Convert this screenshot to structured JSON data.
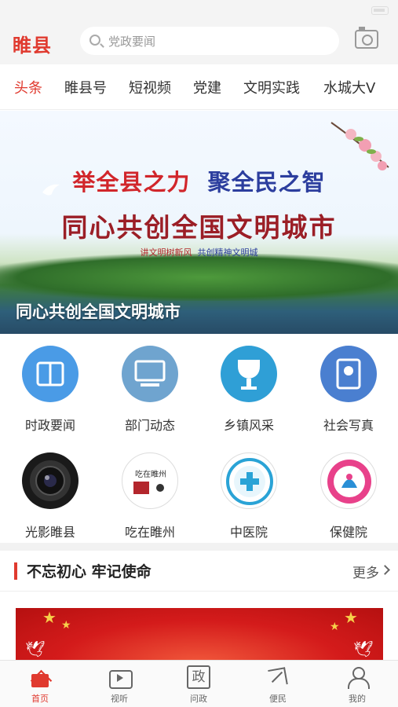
{
  "header": {
    "logo": "睢县",
    "search_placeholder": "党政要闻"
  },
  "tabs": [
    "头条",
    "睢县号",
    "短视频",
    "党建",
    "文明实践",
    "水城大V"
  ],
  "banner": {
    "line1_a": "举全县之力",
    "line1_b": "聚全民之智",
    "line2": "同心共创全国文明城市",
    "slogan_a": "讲文明树新风",
    "slogan_b": "共创精神文明城",
    "caption": "同心共创全国文明城市"
  },
  "grid": [
    {
      "label": "时政要闻",
      "icon": "book-icon"
    },
    {
      "label": "部门动态",
      "icon": "monitor-icon"
    },
    {
      "label": "乡镇风采",
      "icon": "trophy-icon"
    },
    {
      "label": "社会写真",
      "icon": "album-icon"
    },
    {
      "label": "光影睢县",
      "icon": "camera-lens-icon"
    },
    {
      "label": "吃在睢州",
      "icon": "food-logo-icon",
      "logo_text": "吃在睢州"
    },
    {
      "label": "中医院",
      "icon": "hospital-logo-icon"
    },
    {
      "label": "保健院",
      "icon": "maternity-logo-icon"
    }
  ],
  "section": {
    "title": "不忘初心 牢记使命",
    "more": "更多"
  },
  "bottom_nav": [
    {
      "label": "首页",
      "icon": "home-icon"
    },
    {
      "label": "视听",
      "icon": "tv-icon"
    },
    {
      "label": "问政",
      "icon": "gov-icon",
      "glyph": "政"
    },
    {
      "label": "便民",
      "icon": "send-icon"
    },
    {
      "label": "我的",
      "icon": "user-icon"
    }
  ],
  "colors": {
    "accent": "#e03a2f",
    "banner_red": "#d1262b",
    "banner_blue": "#2c3e9e"
  }
}
